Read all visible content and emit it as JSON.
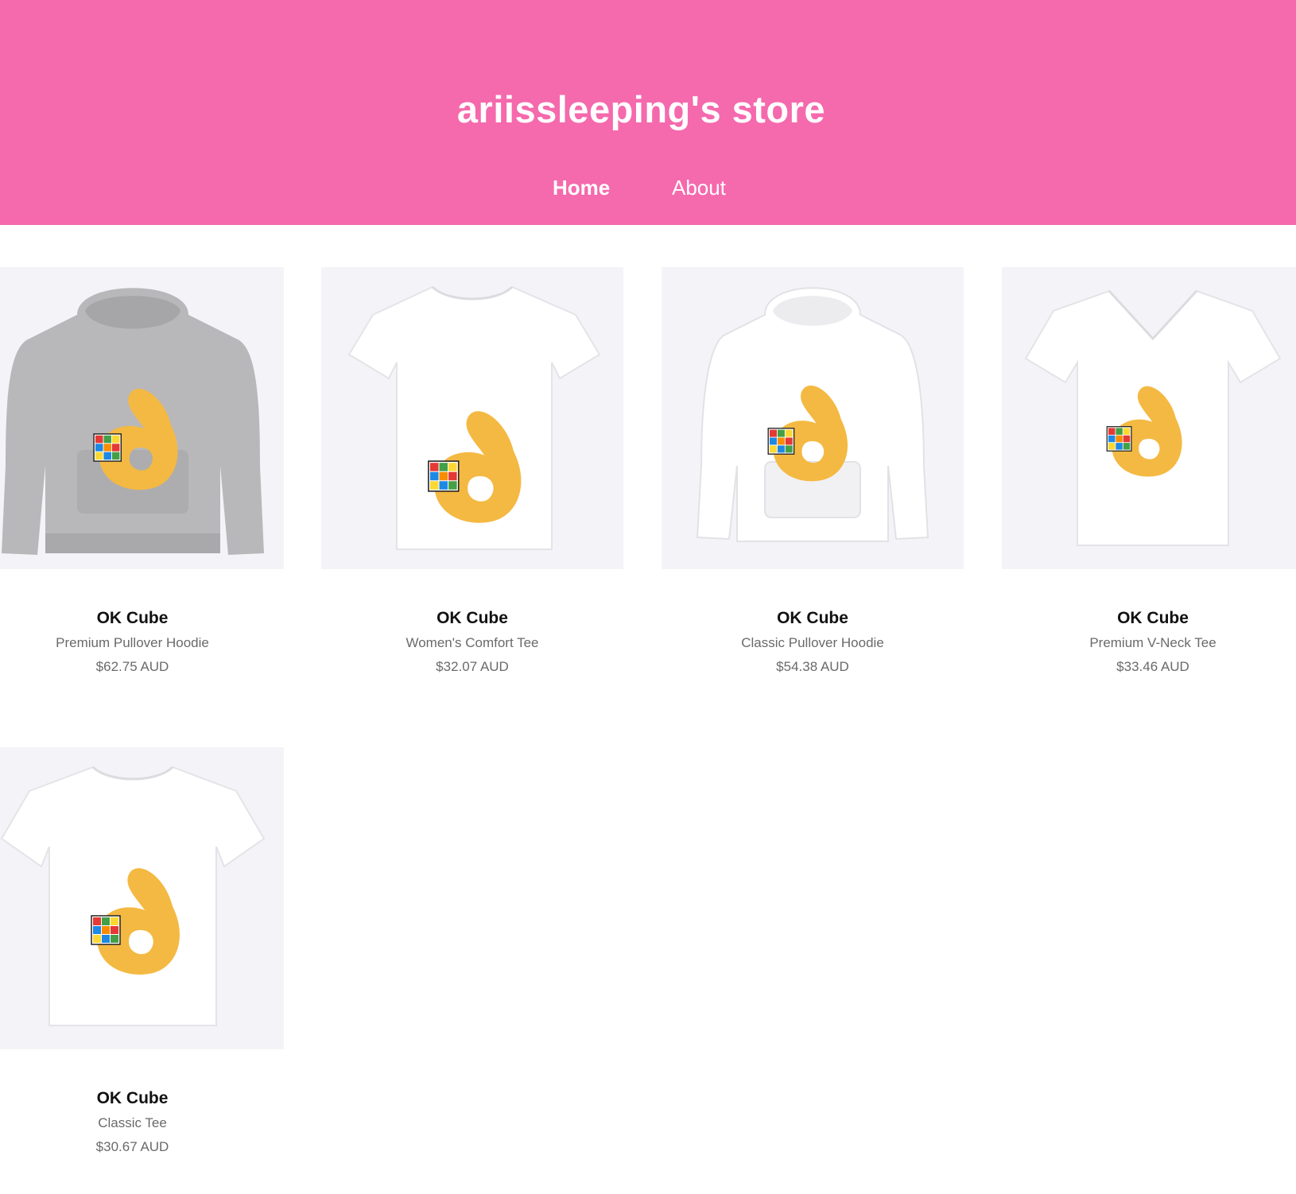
{
  "colors": {
    "header_bg": "#f569ad",
    "thumb_bg": "#f4f4f8",
    "hand": "#f4b942"
  },
  "store": {
    "title": "ariissleeping's store"
  },
  "nav": {
    "home": "Home",
    "about": "About"
  },
  "products": [
    {
      "name": "OK Cube",
      "type": "Premium Pullover Hoodie",
      "price": "$62.75 AUD",
      "garment_icon": "hoodie-icon",
      "garment_color": "grey"
    },
    {
      "name": "OK Cube",
      "type": "Women's Comfort Tee",
      "price": "$32.07 AUD",
      "garment_icon": "tshirt-icon",
      "garment_color": "white"
    },
    {
      "name": "OK Cube",
      "type": "Classic Pullover Hoodie",
      "price": "$54.38 AUD",
      "garment_icon": "hoodie-icon",
      "garment_color": "white"
    },
    {
      "name": "OK Cube",
      "type": "Premium V-Neck Tee",
      "price": "$33.46 AUD",
      "garment_icon": "vneck-tshirt-icon",
      "garment_color": "white"
    },
    {
      "name": "OK Cube",
      "type": "Classic Tee",
      "price": "$30.67 AUD",
      "garment_icon": "tshirt-icon",
      "garment_color": "white"
    }
  ]
}
